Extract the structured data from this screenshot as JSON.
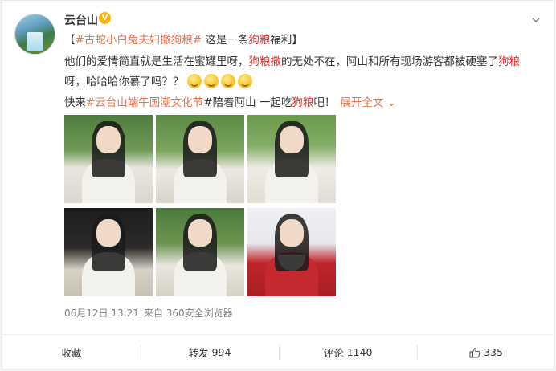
{
  "post": {
    "author": "云台山",
    "line1": {
      "bracket_open": "【",
      "tag": "#古蛇小白兔夫妇撒狗粮#",
      "text_a": " 这是一条",
      "hl": "狗粮",
      "text_b": "福利",
      "bracket_close": "】"
    },
    "line2": {
      "text_a": "他们的爱情简直就是生活在蜜罐里呀，",
      "hl_a": "狗粮撒",
      "text_b": "的无处不在，阿山和所有现场游客都被硬塞了",
      "hl_b": "狗粮"
    },
    "line3": {
      "text_a": "呀，哈哈哈你慕了吗？？"
    },
    "line4": {
      "text_a": "快来",
      "tag": "#云台山端午国潮文化节",
      "text_b": "#陪着阿山 一起吃",
      "hl": "狗粮",
      "text_c": "吧！",
      "expand": "展开全文",
      "expand_arrow": "⌄"
    },
    "emojis": [
      "haha-emoji",
      "haha-emoji",
      "haha-emoji",
      "haha-emoji"
    ],
    "date": "06月12日 13:21",
    "source": "来自 360安全浏览器"
  },
  "actions": {
    "collect": "收藏",
    "repost_label": "转发",
    "repost_count": "994",
    "comment_label": "评论",
    "comment_count": "1140",
    "like_count": "335"
  },
  "colors": {
    "tag": "#eb7350",
    "highlight": "#e0302c",
    "verified": "#ffb400"
  }
}
